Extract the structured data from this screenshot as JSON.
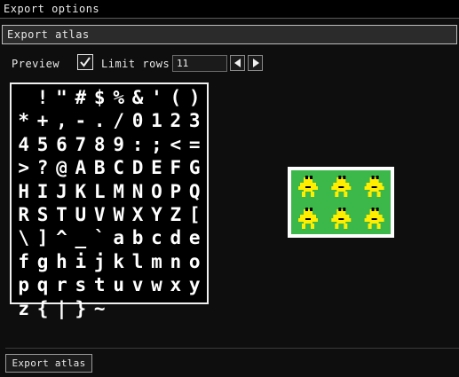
{
  "window": {
    "title": "Export options"
  },
  "section": {
    "title": "Export atlas"
  },
  "toolbar": {
    "preview_label": "Preview",
    "limit_rows_checked": true,
    "limit_rows_label": "Limit rows",
    "limit_rows_value": "11"
  },
  "glyphs": [
    " ",
    "!",
    "\"",
    "#",
    "$",
    "%",
    "&",
    "'",
    "(",
    ")",
    "*",
    "+",
    ",",
    "-",
    ".",
    "/",
    "0",
    "1",
    "2",
    "3",
    "4",
    "5",
    "6",
    "7",
    "8",
    "9",
    ":",
    ";",
    "<",
    "=",
    ">",
    "?",
    "@",
    "A",
    "B",
    "C",
    "D",
    "E",
    "F",
    "G",
    "H",
    "I",
    "J",
    "K",
    "L",
    "M",
    "N",
    "O",
    "P",
    "Q",
    "R",
    "S",
    "T",
    "U",
    "V",
    "W",
    "X",
    "Y",
    "Z",
    "[",
    "\\",
    "]",
    "^",
    "_",
    "`",
    "a",
    "b",
    "c",
    "d",
    "e",
    "f",
    "g",
    "h",
    "i",
    "j",
    "k",
    "l",
    "m",
    "n",
    "o",
    "p",
    "q",
    "r",
    "s",
    "t",
    "u",
    "v",
    "w",
    "x",
    "y",
    "z",
    "{",
    "|",
    "}",
    "~"
  ],
  "sprite_colors": {
    "background": "#3cb84a",
    "body": "#ffee00",
    "shade": "#000000",
    "frame": "#ffffff"
  },
  "footer": {
    "export_label": "Export atlas"
  },
  "icons": {
    "checkmark": "check-icon",
    "prev": "arrow-left-icon",
    "next": "arrow-right-icon"
  }
}
